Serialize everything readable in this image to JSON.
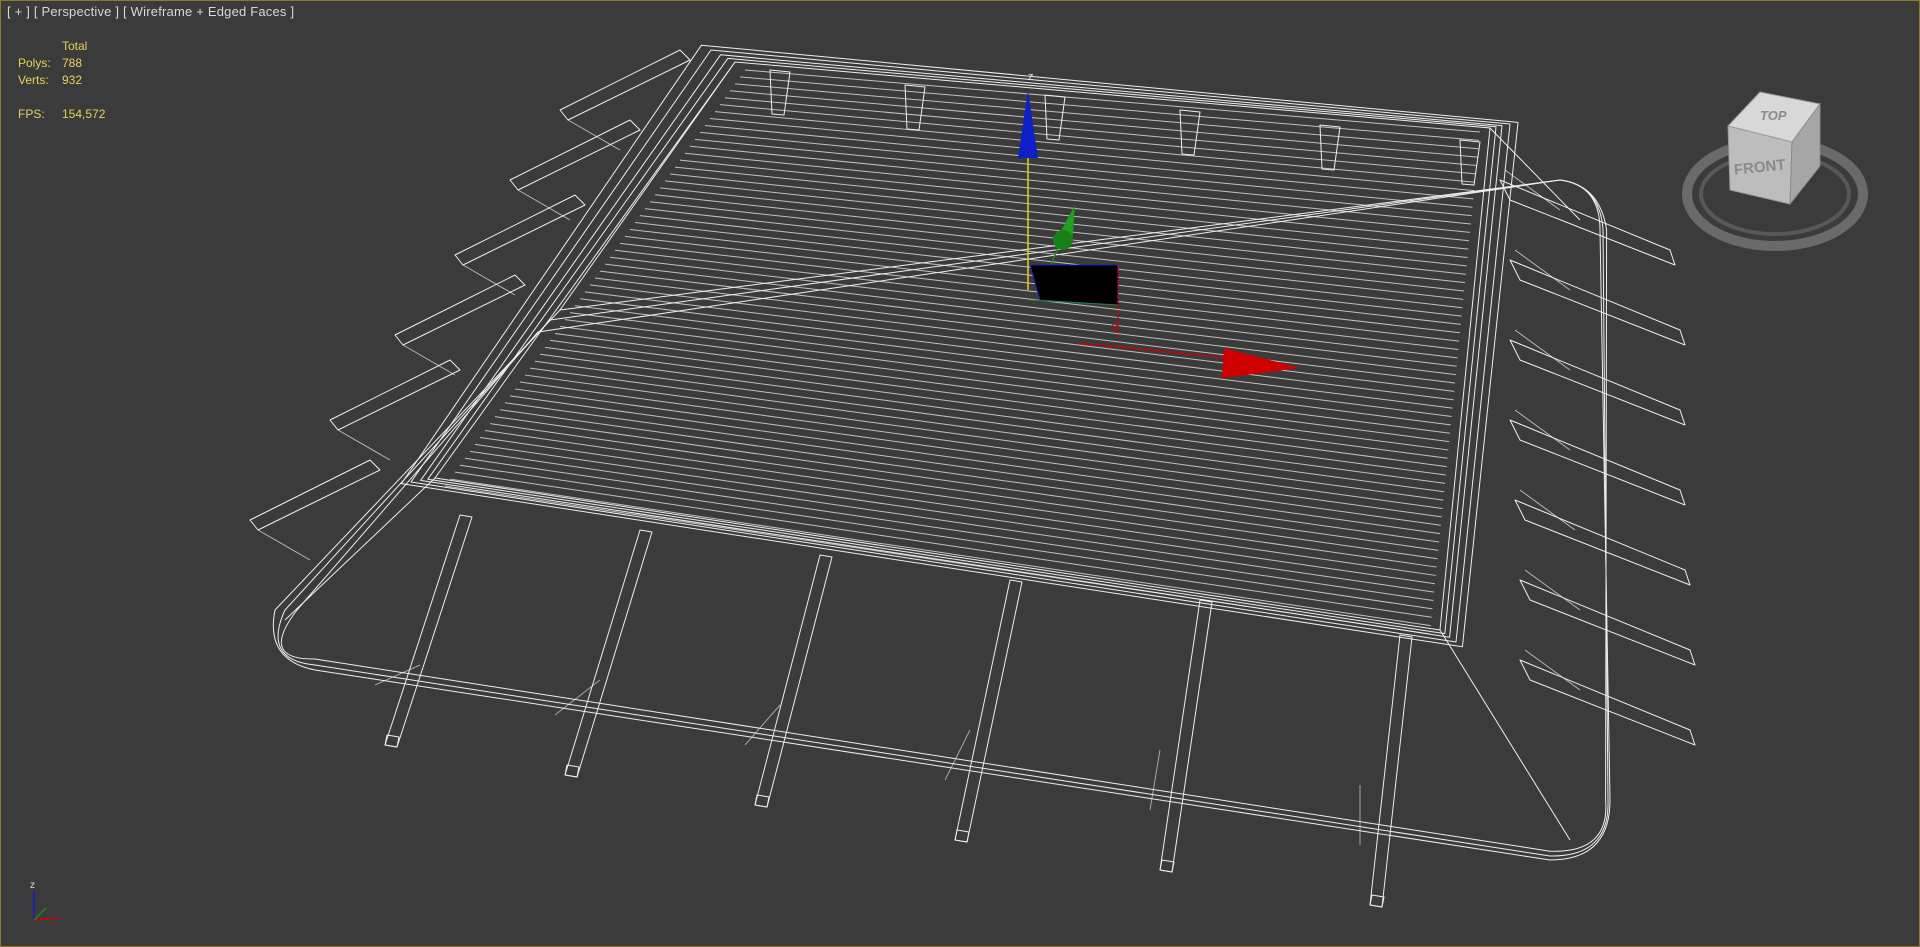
{
  "viewport": {
    "label_plus": "[ + ]",
    "label_view": "[ Perspective ]",
    "label_shading": "[ Wireframe + Edged Faces ]"
  },
  "stats": {
    "header": "Total",
    "polys_label": "Polys:",
    "polys_value": "788",
    "verts_label": "Verts:",
    "verts_value": "932",
    "fps_label": "FPS:",
    "fps_value": "154,572"
  },
  "gizmo": {
    "z_label": "z",
    "y_label": "y"
  },
  "viewcube": {
    "top_label": "TOP",
    "front_label": "FRONT"
  },
  "corner_axis": {
    "z_label": "z"
  },
  "colors": {
    "background": "#3b3b3b",
    "wire": "#ffffff",
    "stats_text": "#e6d25a",
    "x_axis": "#d10000",
    "y_axis": "#1e8a1e",
    "z_axis": "#1020c8",
    "frame_border": "#8a7a2a"
  }
}
